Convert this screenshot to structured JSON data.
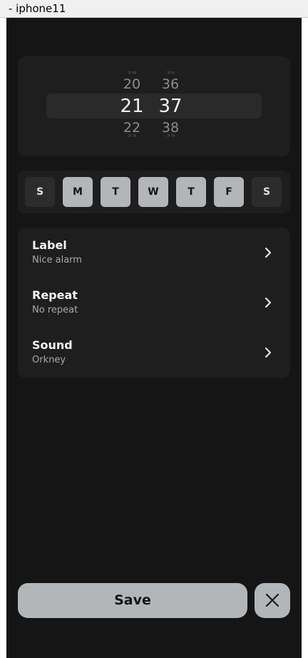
{
  "window": {
    "title": "- iphone11"
  },
  "time_picker": {
    "hours": {
      "far_above": "19",
      "above": "20",
      "selected": "21",
      "below": "22",
      "far_below": "23"
    },
    "minutes": {
      "far_above": "35",
      "above": "36",
      "selected": "37",
      "below": "38",
      "far_below": "39"
    }
  },
  "weekdays": [
    {
      "label": "S",
      "selected": false
    },
    {
      "label": "M",
      "selected": true
    },
    {
      "label": "T",
      "selected": true
    },
    {
      "label": "W",
      "selected": true
    },
    {
      "label": "T",
      "selected": true
    },
    {
      "label": "F",
      "selected": true
    },
    {
      "label": "S",
      "selected": false
    }
  ],
  "settings": [
    {
      "title": "Label",
      "value": "Nice alarm",
      "icon": "chevron-right-icon"
    },
    {
      "title": "Repeat",
      "value": "No repeat",
      "icon": "chevron-right-icon"
    },
    {
      "title": "Sound",
      "value": "Orkney",
      "icon": "chevron-right-icon"
    }
  ],
  "actions": {
    "save_label": "Save",
    "close_icon": "close-icon"
  },
  "colors": {
    "background": "#151515",
    "card": "#1e1e1f",
    "day_selected": "#b3b6b8",
    "day_unselected": "#2c2c2d",
    "button": "#b3b6b8"
  }
}
